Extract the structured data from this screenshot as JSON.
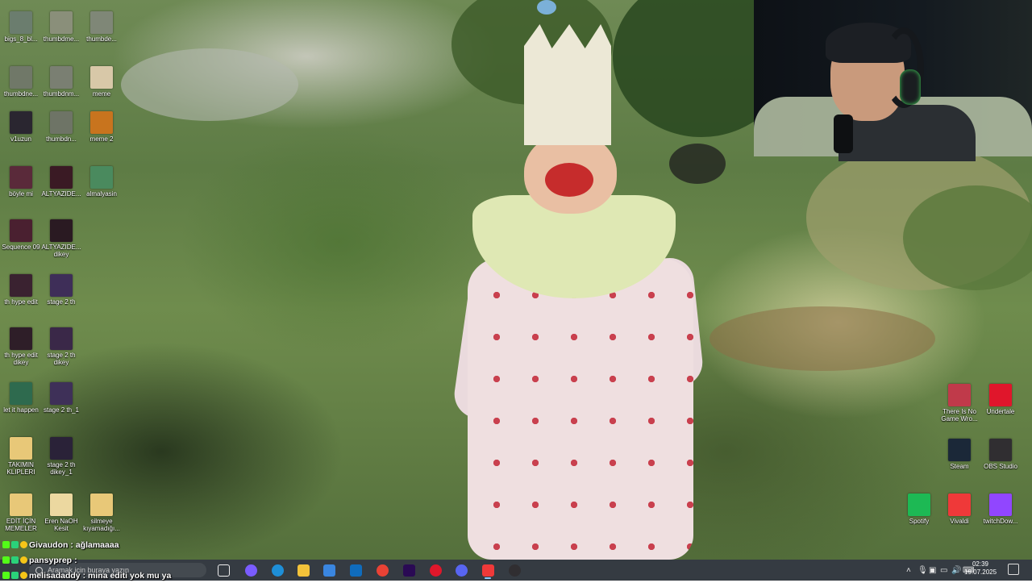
{
  "desktop": {
    "icons_left": [
      {
        "label": "bigs_8_bl...",
        "color": "#6b7d6e"
      },
      {
        "label": "thumbdme...",
        "color": "#8a8f7a"
      },
      {
        "label": "thumbde...",
        "color": "#7f8777"
      },
      {
        "label": "thumbdne...",
        "color": "#707868"
      },
      {
        "label": "thumbdnm...",
        "color": "#7a7f72"
      },
      {
        "label": "meme",
        "color": "#d8c8a8"
      },
      {
        "label": "v1uzun",
        "color": "#2a2630"
      },
      {
        "label": "thumbdn...",
        "color": "#6e7466"
      },
      {
        "label": "meme 2",
        "color": "#c8741e"
      },
      {
        "label": "böyle mi",
        "color": "#5a2a3a"
      },
      {
        "label": "ALTYAZIDE...",
        "color": "#3a1a24"
      },
      {
        "label": "almalyasin",
        "color": "#4a8a5e"
      },
      {
        "label": "Sequence 09",
        "color": "#4a2030"
      },
      {
        "label": "ALTYAZIDE... dikey",
        "color": "#2a1a22"
      },
      {
        "label": "th hype edit",
        "color": "#3a2230"
      },
      {
        "label": "stage 2 th",
        "color": "#3e2e58"
      },
      {
        "label": "th hype edit dikey",
        "color": "#2e1e28"
      },
      {
        "label": "stage 2 th dikey",
        "color": "#3a2848"
      },
      {
        "label": "let it happen",
        "color": "#2e6a4e"
      },
      {
        "label": "stage 2 th_1",
        "color": "#3e3058"
      },
      {
        "label": "TAKIMIN KLIPLERI",
        "color": "#e8c878"
      },
      {
        "label": "stage 2 th dikey_1",
        "color": "#2a2238"
      },
      {
        "label": "EDİT İÇİN MEMELER",
        "color": "#e8c878"
      },
      {
        "label": "Eren NaOH Kesit",
        "color": "#ecd8a0"
      },
      {
        "label": "silmeye kıyamadığı...",
        "color": "#e8c878"
      }
    ],
    "icons_right": [
      {
        "label": "There Is No Game Wro...",
        "color": "#c03a4a"
      },
      {
        "label": "Undertale",
        "color": "#e0162b"
      },
      {
        "label": "Steam",
        "color": "#1b2838"
      },
      {
        "label": "OBS Studio",
        "color": "#302e31"
      },
      {
        "label": "Spotify",
        "color": "#1db954"
      },
      {
        "label": "Vivaldi",
        "color": "#ef3939"
      },
      {
        "label": "twitchDow...",
        "color": "#9146ff"
      }
    ]
  },
  "chat": {
    "messages": [
      {
        "user": "Givaudon",
        "text": ": ağlamaaaa"
      },
      {
        "user": "pansyprep",
        "text": ":"
      },
      {
        "user": "melisadaddy",
        "text": ": mina editi yok mu ya"
      }
    ]
  },
  "taskbar": {
    "search_placeholder": "Aramak için buraya yazın",
    "apps": [
      {
        "name": "task-view",
        "color": "#ffffff"
      },
      {
        "name": "copilot",
        "color": "#7a5cff"
      },
      {
        "name": "edge",
        "color": "#1e8fd8"
      },
      {
        "name": "file-explorer",
        "color": "#f3c33a"
      },
      {
        "name": "microsoft-store",
        "color": "#3a86e0"
      },
      {
        "name": "outlook",
        "color": "#0f6cbd"
      },
      {
        "name": "chrome",
        "color": "#e94235"
      },
      {
        "name": "premiere-pro",
        "color": "#2a0a54"
      },
      {
        "name": "opera",
        "color": "#e0172b"
      },
      {
        "name": "discord",
        "color": "#5865f2"
      },
      {
        "name": "vivaldi",
        "color": "#ef3939"
      },
      {
        "name": "obs-studio",
        "color": "#302e31"
      }
    ],
    "time": "02:39",
    "date": "19.07.2025"
  }
}
